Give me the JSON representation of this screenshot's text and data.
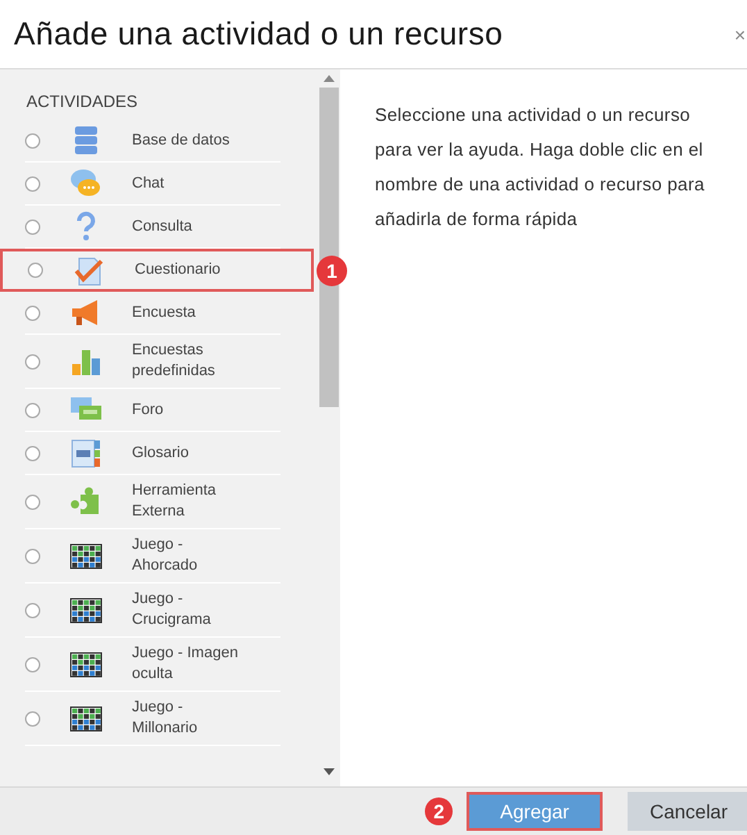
{
  "dialog": {
    "title": "Añade una actividad o un recurso",
    "close": "×"
  },
  "section_heading": "ACTIVIDADES",
  "items": [
    {
      "label": "Base de datos",
      "kind": "database",
      "selected": false,
      "highlighted": false
    },
    {
      "label": "Chat",
      "kind": "chat",
      "selected": false,
      "highlighted": false
    },
    {
      "label": "Consulta",
      "kind": "question",
      "selected": false,
      "highlighted": false
    },
    {
      "label": "Cuestionario",
      "kind": "quiz",
      "selected": false,
      "highlighted": true,
      "annotation": "1"
    },
    {
      "label": "Encuesta",
      "kind": "megaphone",
      "selected": false,
      "highlighted": false
    },
    {
      "label": "Encuestas predefinidas",
      "kind": "chart",
      "selected": false,
      "highlighted": false
    },
    {
      "label": "Foro",
      "kind": "forum",
      "selected": false,
      "highlighted": false
    },
    {
      "label": "Glosario",
      "kind": "glossary",
      "selected": false,
      "highlighted": false
    },
    {
      "label": "Herramienta Externa",
      "kind": "puzzle",
      "selected": false,
      "highlighted": false
    },
    {
      "label": "Juego - Ahorcado",
      "kind": "game",
      "selected": false,
      "highlighted": false
    },
    {
      "label": "Juego - Crucigrama",
      "kind": "game",
      "selected": false,
      "highlighted": false
    },
    {
      "label": "Juego - Imagen oculta",
      "kind": "game",
      "selected": false,
      "highlighted": false
    },
    {
      "label": "Juego - Millonario",
      "kind": "game",
      "selected": false,
      "highlighted": false
    }
  ],
  "help_text": "Seleccione una actividad o un recurso para ver la ayuda. Haga doble clic en el nombre de una actividad o recurso para añadirla de forma rápida",
  "buttons": [
    {
      "label": "Agregar",
      "kind": "primary",
      "highlighted": true,
      "annotation": "2"
    },
    {
      "label": "Cancelar",
      "kind": "secondary",
      "highlighted": false
    }
  ]
}
